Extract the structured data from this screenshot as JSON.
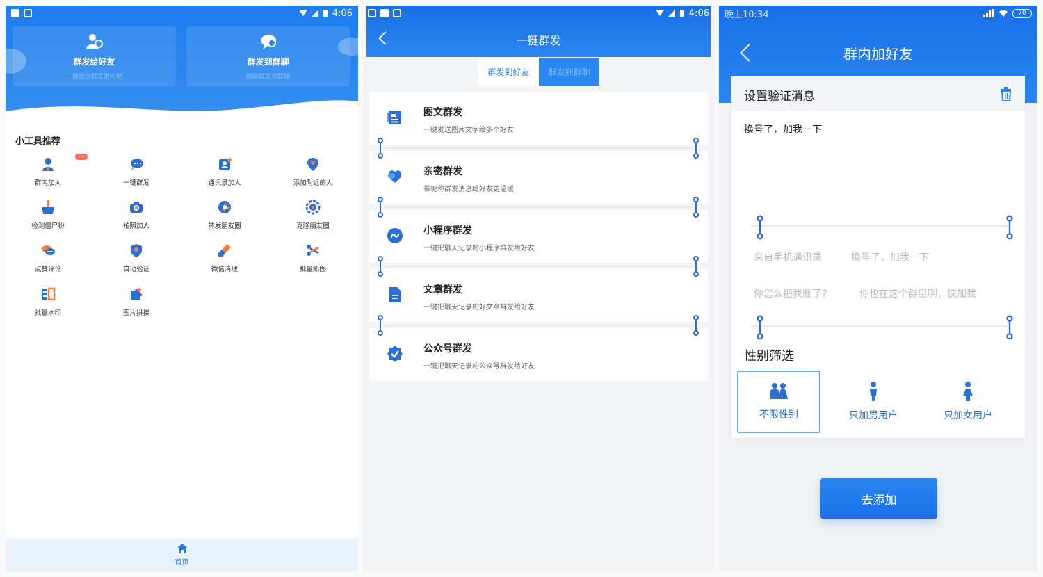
{
  "phone1": {
    "status": {
      "time": "4:06"
    },
    "cards": [
      {
        "title": "群发给好友",
        "subtitle": "一键图文群发更方便"
      },
      {
        "title": "群发到群聊",
        "subtitle": "群聊群发到群聊"
      }
    ],
    "section_title": "小工具推荐",
    "tools": [
      {
        "label": "群内加人",
        "icon": "person-icon"
      },
      {
        "label": "一键群发",
        "icon": "chat-icon"
      },
      {
        "label": "通讯录加人",
        "icon": "contacts-icon"
      },
      {
        "label": "添加附近的人",
        "icon": "location-icon"
      },
      {
        "label": "检测僵尸粉",
        "icon": "broom-icon"
      },
      {
        "label": "拍照加人",
        "icon": "camera-icon"
      },
      {
        "label": "转发朋友圈",
        "icon": "aperture-icon"
      },
      {
        "label": "克隆朋友圈",
        "icon": "clone-icon"
      },
      {
        "label": "点赞评论",
        "icon": "comment-icon"
      },
      {
        "label": "自动验证",
        "icon": "shield-icon"
      },
      {
        "label": "微信清理",
        "icon": "brush-icon"
      },
      {
        "label": "批量抓图",
        "icon": "scissors-icon"
      },
      {
        "label": "批量水印",
        "icon": "watermark-icon"
      },
      {
        "label": "图片拼接",
        "icon": "puzzle-icon"
      }
    ],
    "nav": {
      "home_label": "首页"
    }
  },
  "phone2": {
    "status": {
      "time": "4:06"
    },
    "title": "一键群发",
    "tabs": [
      {
        "label": "群发到好友",
        "active": true
      },
      {
        "label": "群发到群聊",
        "active": false
      }
    ],
    "items": [
      {
        "title": "图文群发",
        "subtitle": "一键发送图片文字给多个好友",
        "icon": "image-text-icon"
      },
      {
        "title": "亲密群发",
        "subtitle": "带昵称群发消息给好友更温暖",
        "icon": "heart-icon"
      },
      {
        "title": "小程序群发",
        "subtitle": "一键把聊天记录的小程序群发给好友",
        "icon": "miniprogram-icon"
      },
      {
        "title": "文章群发",
        "subtitle": "一键把聊天记录的好文章群发给好友",
        "icon": "article-icon"
      },
      {
        "title": "公众号群发",
        "subtitle": "一键把聊天记录的公众号群发给好友",
        "icon": "badge-check-icon"
      }
    ]
  },
  "phone3": {
    "status": {
      "time": "晚上10:34",
      "battery": "70"
    },
    "title": "群内加好友",
    "verify_title": "设置验证消息",
    "message": "换号了，加我一下",
    "chips": [
      "来自手机通讯录",
      "换号了，加我一下",
      "你怎么把我删了?",
      "你也在这个群里啊，快加我"
    ],
    "gender_title": "性别筛选",
    "gender_options": [
      {
        "label": "不限性别",
        "selected": true
      },
      {
        "label": "只加男用户",
        "selected": false
      },
      {
        "label": "只加女用户",
        "selected": false
      }
    ],
    "add_button": "去添加"
  },
  "colors": {
    "primary": "#1a6fe8",
    "accent": "#2a86f0"
  }
}
